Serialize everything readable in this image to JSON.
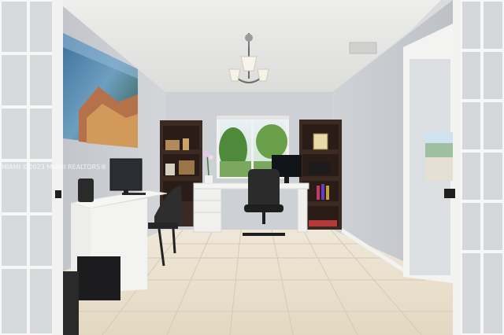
{
  "photo": {
    "subject": "home office interior",
    "watermark": "MIAMI ©2023 MIAMI REALTORS®"
  },
  "colors": {
    "ceiling": "#e6e6e3",
    "wall": "#c9ccd0",
    "floor_tile": "#e9e0cf",
    "grout": "#d6ccb8",
    "bookshelf": "#3b2a22",
    "desk": "#f4f4f2",
    "door_frame": "#f7f7f5",
    "greenery": "#4f8a3a"
  }
}
